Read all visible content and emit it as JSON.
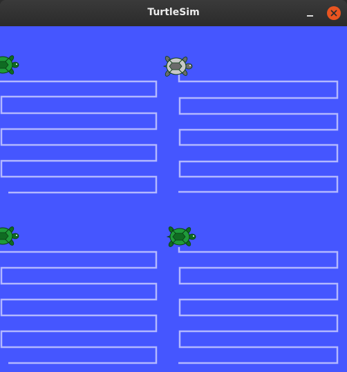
{
  "window": {
    "title": "TurtleSim",
    "minimize_icon": "minimize-icon",
    "close_icon": "close-icon"
  },
  "colors": {
    "background": "#4556ff",
    "pen": "#b3b8ff",
    "turtle_shell": "#1f9a3a",
    "turtle_dark": "#0f6b22",
    "turtle_active": "#c8c8c8",
    "close_button": "#e95420"
  },
  "turtles": [
    {
      "name": "turtle-top-left",
      "icon": "turtle-icon",
      "heading": "east"
    },
    {
      "name": "turtle-top-right",
      "icon": "turtle-icon",
      "heading": "east",
      "active": true
    },
    {
      "name": "turtle-bottom-left",
      "icon": "turtle-icon",
      "heading": "east"
    },
    {
      "name": "turtle-bottom-right",
      "icon": "turtle-icon",
      "heading": "east"
    }
  ]
}
